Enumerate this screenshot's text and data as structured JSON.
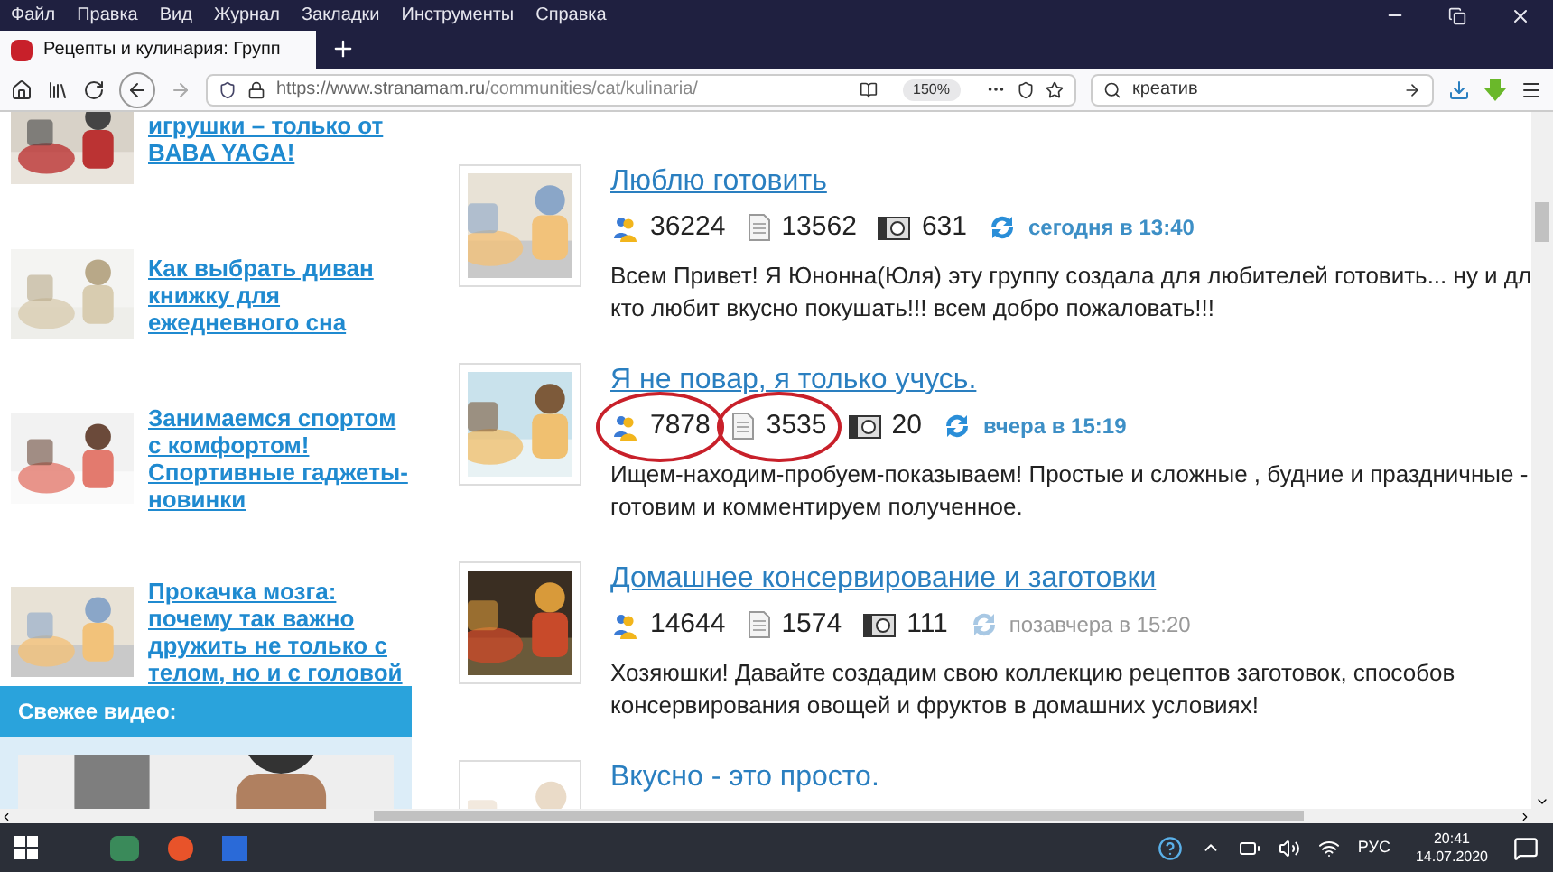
{
  "menu_bar": [
    "Файл",
    "Правка",
    "Вид",
    "Журнал",
    "Закладки",
    "Инструменты",
    "Справка"
  ],
  "tabs": [
    {
      "label": "Рецепты и кулинария: Групп",
      "selected": true
    }
  ],
  "address_bar": {
    "url_host": "https://www.stranamam.ru",
    "url_path": "/communities/cat/kulinaria/",
    "zoom": "150%"
  },
  "search": {
    "value": "креатив"
  },
  "sidebar": {
    "articles": [
      {
        "title": "игрушки – только от BABA YAGA!",
        "kind": "picture"
      },
      {
        "title": "Как выбрать диван книжку для ежедневного сна",
        "kind": "picture"
      },
      {
        "title": "Занимаемся спортом с комфортом! Спортивные гаджеты-новинки",
        "kind": "picture"
      },
      {
        "title": "Прокачка мозга: почему так важно дружить не только с телом, но и с головой",
        "kind": "picture"
      }
    ],
    "video_header": "Свежее видео:"
  },
  "groups": [
    {
      "title": "Люблю готовить",
      "members": "36224",
      "posts": "13562",
      "photos": "631",
      "updated": "сегодня в 13:40",
      "recent": true,
      "members_circled": false,
      "posts_circled": false,
      "description": [
        "Всем Привет! Я Юнонна(Юля) эту группу создала для любителей готовить... ну и дл",
        "кто любит вкусно покушать!!! всем добро пожаловать!!!"
      ]
    },
    {
      "title": "Я не повар, я только учусь.",
      "members": "7878",
      "posts": "3535",
      "photos": "20",
      "updated": "вчера в 15:19",
      "recent": true,
      "members_circled": true,
      "posts_circled": true,
      "description": [
        "Ищем-находим-пробуем-показываем! Простые и сложные , будние и праздничные -",
        "готовим и комментируем полученное."
      ]
    },
    {
      "title": "Домашнее консервирование и заготовки",
      "members": "14644",
      "posts": "1574",
      "photos": "111",
      "updated": "позавчера в 15:20",
      "recent": false,
      "members_circled": false,
      "posts_circled": false,
      "description": [
        "Хозяюшки! Давайте создадим свою коллекцию рецептов заготовок, способов",
        "консервирования овощей и фруктов в домашних условиях!"
      ]
    },
    {
      "title": "Вкусно - это просто.",
      "kind": "partial"
    }
  ],
  "taskbar": {
    "language": "РУС",
    "time": "20:41",
    "date": "14.07.2020"
  }
}
